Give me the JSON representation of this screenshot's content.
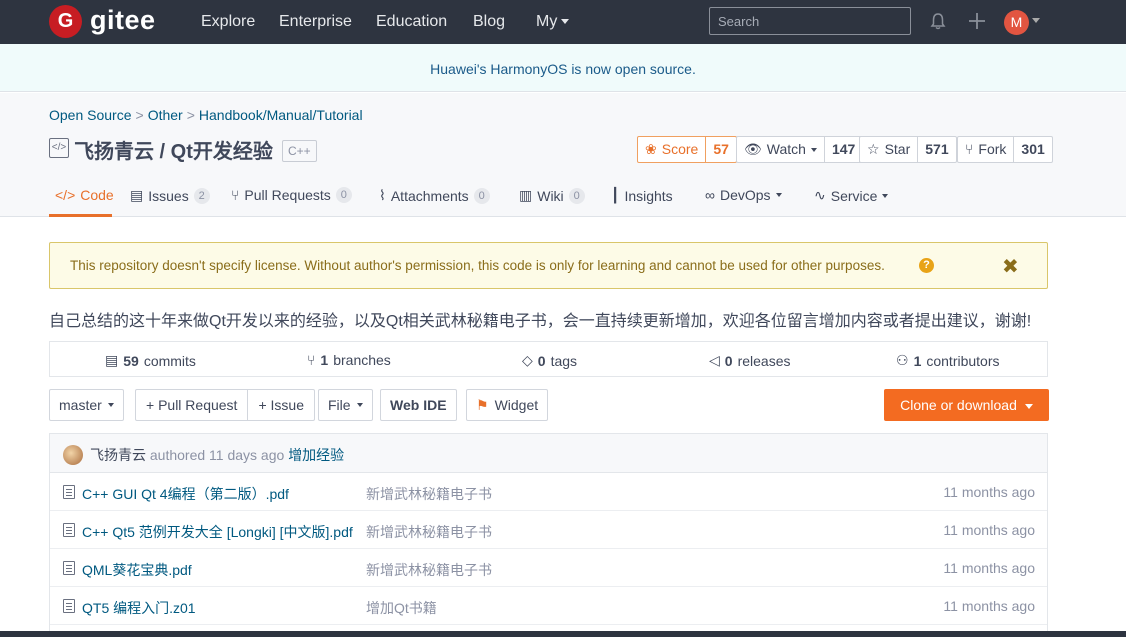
{
  "topnav": {
    "logo_letter": "G",
    "logo_text": "gitee",
    "links": [
      "Explore",
      "Enterprise",
      "Education",
      "Blog",
      "My"
    ],
    "search_placeholder": "Search",
    "avatar_letter": "M",
    "colors": {
      "bar": "#2e3440",
      "logo": "#c71d23",
      "avatar": "#e25541"
    }
  },
  "banner": {
    "text": "Huawei's HarmonyOS is now open source."
  },
  "breadcrumb": [
    "Open Source",
    "Other",
    "Handbook/Manual/Tutorial"
  ],
  "repo": {
    "title": "飞扬青云 / Qt开发经验",
    "language": "C++",
    "score": {
      "label": "Score",
      "value": "57"
    },
    "watch": {
      "label": "Watch",
      "value": "147"
    },
    "star": {
      "label": "Star",
      "value": "571"
    },
    "fork": {
      "label": "Fork",
      "value": "301"
    }
  },
  "tabs": [
    {
      "label": "Code",
      "icon": "code-icon"
    },
    {
      "label": "Issues",
      "count": "2",
      "icon": "issues-icon"
    },
    {
      "label": "Pull Requests",
      "count": "0",
      "icon": "pull-request-icon"
    },
    {
      "label": "Attachments",
      "count": "0",
      "icon": "paperclip-icon"
    },
    {
      "label": "Wiki",
      "count": "0",
      "icon": "book-icon"
    },
    {
      "label": "Insights",
      "icon": "bar-chart-icon"
    },
    {
      "label": "DevOps",
      "icon": "infinity-icon"
    },
    {
      "label": "Service",
      "icon": "pulse-icon"
    }
  ],
  "license_warning": "This repository doesn't specify license. Without author's permission, this code is only for learning and cannot be used for other purposes.",
  "description": "自己总结的这十年来做Qt开发以来的经验，以及Qt相关武林秘籍电子书，会一直持续更新增加，欢迎各位留言增加内容或者提出建议，谢谢!",
  "stats": {
    "commits": {
      "count": "59",
      "label": "commits"
    },
    "branches": {
      "count": "1",
      "label": "branches"
    },
    "tags": {
      "count": "0",
      "label": "tags"
    },
    "releases": {
      "count": "0",
      "label": "releases"
    },
    "contributors": {
      "count": "1",
      "label": "contributors"
    }
  },
  "actions": {
    "branch": "master",
    "pull_request": "+ Pull Request",
    "issue": "+ Issue",
    "file": "File",
    "web_ide": "Web IDE",
    "widget": "Widget",
    "clone": "Clone or download"
  },
  "latest_commit": {
    "author": "飞扬青云",
    "authored": "authored 11 days ago",
    "message": "增加经验"
  },
  "files": [
    {
      "name": "C++ GUI Qt 4编程（第二版）.pdf",
      "message": "新增武林秘籍电子书",
      "time": "11 months ago"
    },
    {
      "name": "C++ Qt5 范例开发大全 [Longki] [中文版].pdf",
      "message": "新增武林秘籍电子书",
      "time": "11 months ago"
    },
    {
      "name": "QML葵花宝典.pdf",
      "message": "新增武林秘籍电子书",
      "time": "11 months ago"
    },
    {
      "name": "QT5 编程入门.z01",
      "message": "增加Qt书籍",
      "time": "11 months ago"
    }
  ]
}
